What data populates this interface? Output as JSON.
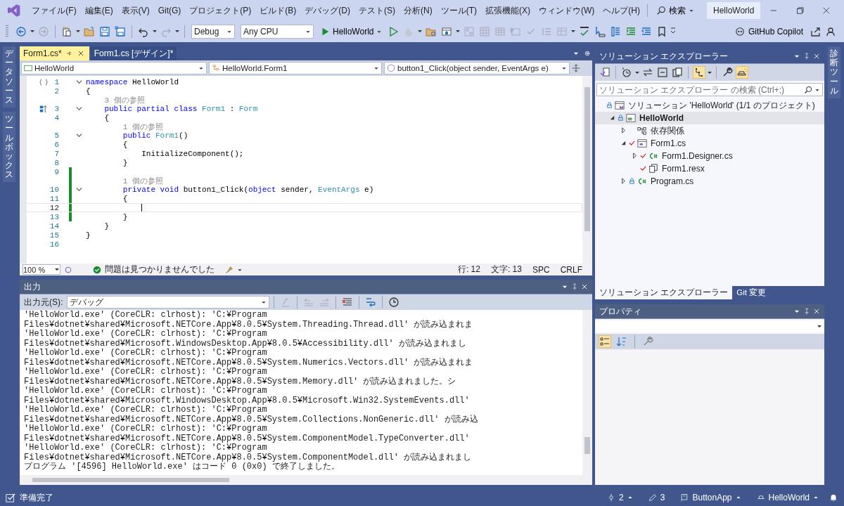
{
  "menu": [
    "ファイル(F)",
    "編集(E)",
    "表示(V)",
    "Git(G)",
    "プロジェクト(P)",
    "ビルド(B)",
    "デバッグ(D)",
    "テスト(S)",
    "分析(N)",
    "ツール(T)",
    "拡張機能(X)",
    "ウィンドウ(W)",
    "ヘルプ(H)"
  ],
  "search": {
    "label": "検索"
  },
  "window": {
    "title": "HelloWorld"
  },
  "toolbar": {
    "configuration": "Debug",
    "platform": "Any CPU",
    "run_target": "HelloWorld",
    "copilot": "GitHub Copilot"
  },
  "left_strip": [
    "データソース",
    "ツールボックス"
  ],
  "right_strip": [
    "診断ツール"
  ],
  "editor": {
    "tabs": [
      {
        "label": "Form1.cs*",
        "selected": true
      },
      {
        "label": "Form1.cs [デザイン]*",
        "selected": false
      }
    ],
    "nav": [
      "HelloWorld",
      "HelloWorld.Form1",
      "button1_Click(object sender, EventArgs e)"
    ],
    "lines": [
      {
        "n": "1",
        "gutter_icon": {
          "kind": "namespace"
        },
        "fold": true,
        "changed": false,
        "current": false,
        "tokens": [
          {
            "t": "namespace",
            "kind": "keyword"
          },
          {
            "t": " HelloWorld",
            "kind": "plain"
          }
        ]
      },
      {
        "n": "2",
        "fold": false,
        "changed": false,
        "current": false,
        "tokens": [
          {
            "t": "{",
            "kind": "plain"
          }
        ]
      },
      {
        "n": "3",
        "gutter_icon": {
          "kind": "class"
        },
        "codelens": "3 個の参照",
        "fold": true,
        "changed": false,
        "current": false,
        "tokens": [
          {
            "t": "    public partial class",
            "kind": "keyword"
          },
          {
            "t": " Form1",
            "kind": "type"
          },
          {
            "t": " : ",
            "kind": "plain"
          },
          {
            "t": "Form",
            "kind": "type"
          }
        ]
      },
      {
        "n": "4",
        "fold": false,
        "changed": false,
        "current": false,
        "tokens": [
          {
            "t": "    {",
            "kind": "plain"
          }
        ]
      },
      {
        "n": "5",
        "codelens": "1 個の参照",
        "fold": true,
        "changed": false,
        "current": false,
        "tokens": [
          {
            "t": "        public",
            "kind": "keyword"
          },
          {
            "t": " Form1",
            "kind": "type"
          },
          {
            "t": "()",
            "kind": "plain"
          }
        ]
      },
      {
        "n": "6",
        "fold": false,
        "changed": false,
        "current": false,
        "tokens": [
          {
            "t": "        {",
            "kind": "plain"
          }
        ]
      },
      {
        "n": "7",
        "fold": false,
        "changed": false,
        "current": false,
        "tokens": [
          {
            "t": "            InitializeComponent();",
            "kind": "plain"
          }
        ]
      },
      {
        "n": "8",
        "fold": false,
        "changed": false,
        "current": false,
        "tokens": [
          {
            "t": "        }",
            "kind": "plain"
          }
        ]
      },
      {
        "n": "9",
        "fold": false,
        "changed": true,
        "current": false
      },
      {
        "n": "10",
        "codelens": "1 個の参照",
        "fold": true,
        "changed": true,
        "current": false,
        "tokens": [
          {
            "t": "        private void",
            "kind": "keyword"
          },
          {
            "t": " button1_Click(",
            "kind": "plain"
          },
          {
            "t": "object",
            "kind": "keyword"
          },
          {
            "t": " sender, ",
            "kind": "plain"
          },
          {
            "t": "EventArgs",
            "kind": "type"
          },
          {
            "t": " e)",
            "kind": "plain"
          }
        ]
      },
      {
        "n": "11",
        "fold": false,
        "changed": true,
        "current": false,
        "tokens": [
          {
            "t": "        {",
            "kind": "plain"
          }
        ]
      },
      {
        "n": "12",
        "fold": false,
        "changed": true,
        "current": true
      },
      {
        "n": "13",
        "fold": false,
        "changed": true,
        "current": false,
        "tokens": [
          {
            "t": "        }",
            "kind": "plain"
          }
        ]
      },
      {
        "n": "14",
        "fold": false,
        "changed": false,
        "current": false,
        "tokens": [
          {
            "t": "    }",
            "kind": "plain"
          }
        ]
      },
      {
        "n": "15",
        "fold": false,
        "changed": false,
        "current": false,
        "tokens": [
          {
            "t": "}",
            "kind": "plain"
          }
        ]
      },
      {
        "n": "16",
        "fold": false,
        "changed": false,
        "current": false
      }
    ],
    "status": {
      "zoom": "100 %",
      "issues": "問題は見つかりませんでした",
      "line": "行: 12",
      "char": "文字: 13",
      "whitespace": "SPC",
      "eol": "CRLF"
    }
  },
  "output": {
    "title": "出力",
    "source_label": "出力元(S):",
    "source": "デバッグ",
    "lines": [
      "'HelloWorld.exe' (CoreCLR: clrhost): 'C:¥Program Files¥dotnet¥shared¥Microsoft.NETCore.App¥8.0.5¥System.Threading.Thread.dll' が読み込まれま",
      "'HelloWorld.exe' (CoreCLR: clrhost): 'C:¥Program Files¥dotnet¥shared¥Microsoft.WindowsDesktop.App¥8.0.5¥Accessibility.dll' が読み込まれまし",
      "'HelloWorld.exe' (CoreCLR: clrhost): 'C:¥Program Files¥dotnet¥shared¥Microsoft.NETCore.App¥8.0.5¥System.Numerics.Vectors.dll' が読み込まれま",
      "'HelloWorld.exe' (CoreCLR: clrhost): 'C:¥Program Files¥dotnet¥shared¥Microsoft.NETCore.App¥8.0.5¥System.Memory.dll' が読み込まれました。シ",
      "'HelloWorld.exe' (CoreCLR: clrhost): 'C:¥Program Files¥dotnet¥shared¥Microsoft.WindowsDesktop.App¥8.0.5¥Microsoft.Win32.SystemEvents.dll'",
      "'HelloWorld.exe' (CoreCLR: clrhost): 'C:¥Program Files¥dotnet¥shared¥Microsoft.NETCore.App¥8.0.5¥System.Collections.NonGeneric.dll' が読み込",
      "'HelloWorld.exe' (CoreCLR: clrhost): 'C:¥Program Files¥dotnet¥shared¥Microsoft.NETCore.App¥8.0.5¥System.ComponentModel.TypeConverter.dll'",
      "'HelloWorld.exe' (CoreCLR: clrhost): 'C:¥Program Files¥dotnet¥shared¥Microsoft.NETCore.App¥8.0.5¥System.ComponentModel.dll' が読み込まれまし",
      "プログラム '[4596] HelloWorld.exe' はコード 0 (0x0) で終了しました。"
    ]
  },
  "solution_explorer": {
    "title": "ソリューション エクスプローラー",
    "search_placeholder": "ソリューション エクスプローラー の検索 (Ctrl+;)",
    "tree": [
      {
        "label": "ソリューション 'HelloWorld' (1/1 のプロジェクト)",
        "kind": "solution",
        "expandable": false,
        "locked": true,
        "edited": false,
        "startup": false,
        "selected": false,
        "children": [
          {
            "label": "HelloWorld",
            "kind": "project",
            "expandable": true,
            "expanded": true,
            "locked": true,
            "edited": false,
            "startup": true,
            "selected": true,
            "children": [
              {
                "label": "依存関係",
                "kind": "deps",
                "expandable": true,
                "expanded": false,
                "locked": false,
                "edited": false,
                "startup": false,
                "selected": false
              },
              {
                "label": "Form1.cs",
                "kind": "form",
                "expandable": true,
                "expanded": true,
                "locked": false,
                "edited": true,
                "startup": false,
                "selected": false,
                "children": [
                  {
                    "label": "Form1.Designer.cs",
                    "kind": "cs",
                    "expandable": true,
                    "expanded": false,
                    "locked": false,
                    "edited": true,
                    "startup": false,
                    "selected": false
                  },
                  {
                    "label": "Form1.resx",
                    "kind": "resx",
                    "expandable": false,
                    "locked": false,
                    "edited": true,
                    "startup": false,
                    "selected": false
                  }
                ]
              },
              {
                "label": "Program.cs",
                "kind": "cs",
                "expandable": true,
                "expanded": false,
                "locked": true,
                "edited": false,
                "startup": false,
                "selected": false
              }
            ]
          }
        ]
      }
    ],
    "tabs": [
      {
        "label": "ソリューション エクスプローラー",
        "selected": true
      },
      {
        "label": "Git 変更",
        "selected": false
      }
    ]
  },
  "properties": {
    "title": "プロパティ"
  },
  "status_bar": {
    "message": "準備完了",
    "up_count": "2",
    "edit_count": "3",
    "repo": "ButtonApp",
    "branch": "HelloWorld"
  }
}
